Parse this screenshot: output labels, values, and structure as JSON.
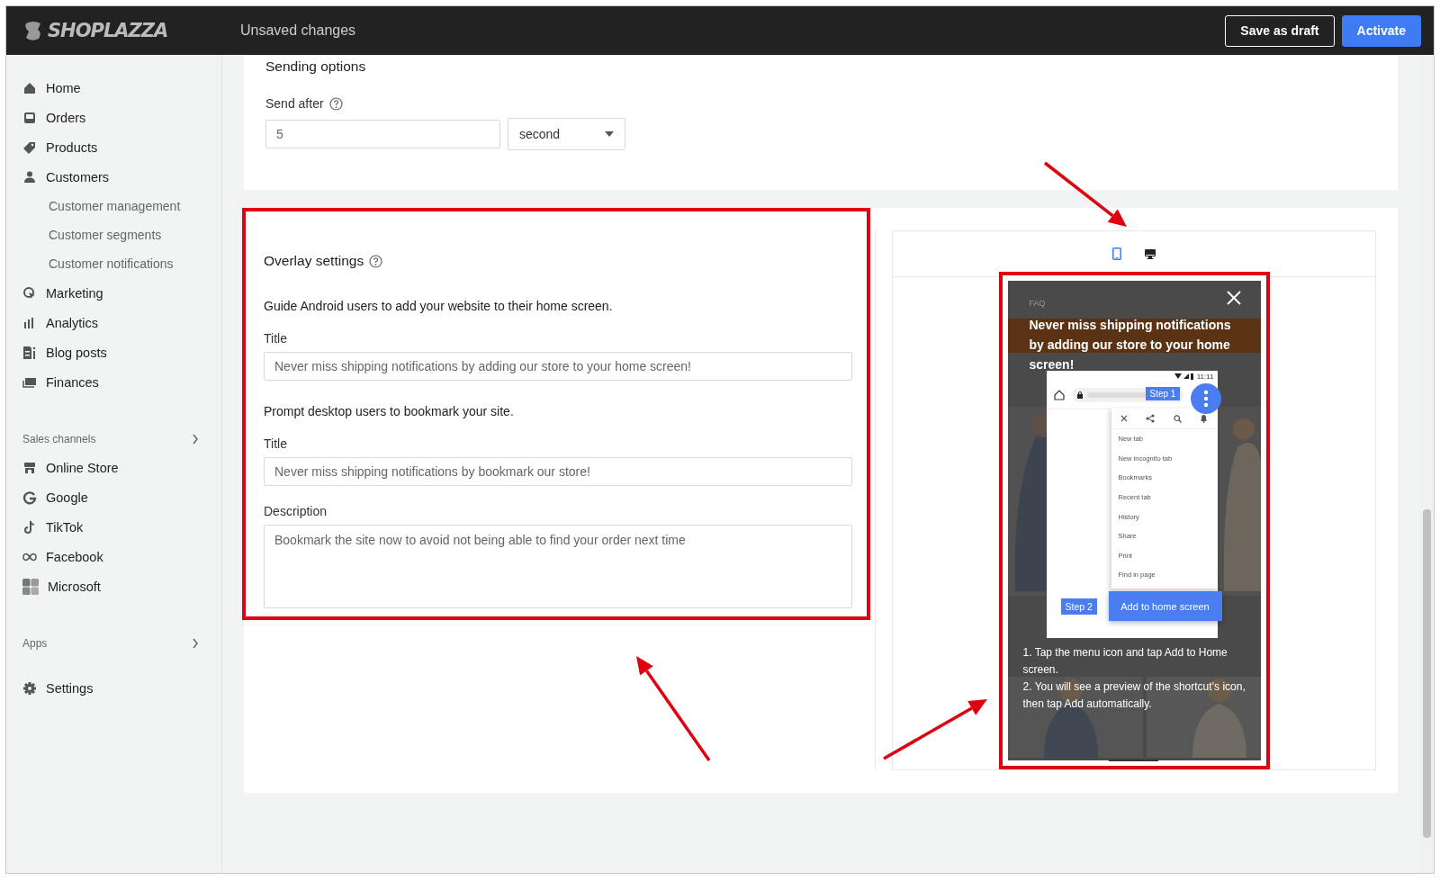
{
  "topbar": {
    "logo": "SHOPLAZZA",
    "status": "Unsaved changes",
    "buttons": [
      {
        "label": "Save as draft",
        "kind": "secondary"
      },
      {
        "label": "Activate",
        "kind": "primary"
      }
    ]
  },
  "sidebar": {
    "groups": [
      {
        "items": [
          {
            "label": "Home",
            "kind": "home"
          },
          {
            "label": "Orders",
            "kind": "orders"
          },
          {
            "label": "Products",
            "kind": "products"
          },
          {
            "label": "Customers",
            "kind": "customers",
            "children": [
              {
                "label": "Customer management"
              },
              {
                "label": "Customer segments"
              },
              {
                "label": "Customer notifications"
              }
            ]
          },
          {
            "label": "Marketing",
            "kind": "marketing"
          },
          {
            "label": "Analytics",
            "kind": "analytics"
          },
          {
            "label": "Blog posts",
            "kind": "blog"
          },
          {
            "label": "Finances",
            "kind": "finances"
          }
        ]
      },
      {
        "title": "Sales channels",
        "items": [
          {
            "label": "Online Store",
            "kind": "store"
          },
          {
            "label": "Google",
            "kind": "google"
          },
          {
            "label": "TikTok",
            "kind": "tiktok"
          },
          {
            "label": "Facebook",
            "kind": "facebook"
          },
          {
            "label": "Microsoft",
            "kind": "microsoft"
          }
        ]
      },
      {
        "title": "Apps"
      },
      {
        "items": [
          {
            "label": "Settings",
            "kind": "settings"
          }
        ]
      }
    ]
  },
  "sending_options": {
    "heading": "Sending options",
    "send_after": {
      "label": "Send after",
      "value": "5",
      "unit": "second"
    }
  },
  "overlay_settings": {
    "heading": "Overlay settings",
    "highlighted": true,
    "android_intro": "Guide Android users to add your website to their home screen.",
    "android_title": {
      "label": "Title",
      "value": "Never miss shipping notifications by adding our store to your home screen!"
    },
    "desktop_intro": "Prompt desktop users to bookmark your site.",
    "desktop_title": {
      "label": "Title",
      "value": "Never miss shipping notifications by bookmark our store!"
    },
    "description": {
      "label": "Description",
      "value": "Bookmark the site now to avoid not being able to find your order next time"
    }
  },
  "preview": {
    "devices": [
      {
        "kind": "mobile",
        "selected": true
      },
      {
        "kind": "desktop",
        "selected": false
      }
    ],
    "phone": {
      "highlighted": true,
      "store_label": "FAQ",
      "title": "Never miss shipping notifications by adding our store to your home screen!",
      "status_time": "11:11",
      "step_1": "Step 1",
      "menu": [
        "New tab",
        "New incognito tab",
        "Bookmarks",
        "Recent tab",
        "History",
        "Share",
        "Print",
        "Find in page"
      ],
      "step_2": "Step 2",
      "add_button": "Add to home screen",
      "instructions": [
        "1. Tap the menu icon and tap Add to Home screen.",
        "2. You will see a preview of the shortcut’s icon, then tap Add automatically."
      ]
    }
  },
  "annotations": [
    {
      "kind": "arrow"
    },
    {
      "kind": "arrow"
    },
    {
      "kind": "arrow"
    }
  ]
}
